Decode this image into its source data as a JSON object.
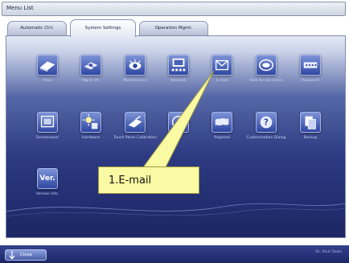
{
  "window": {
    "title": "Menu List"
  },
  "tabs": [
    {
      "label": "Automatic Ctrl."
    },
    {
      "label": "System Settings"
    },
    {
      "label": "Operation Mgmt."
    }
  ],
  "menu": {
    "row1": [
      {
        "label": "Area",
        "icon": "area-icon"
      },
      {
        "label": "Mgmt. Pt.",
        "icon": "management-point-icon"
      },
      {
        "label": "Maintenance",
        "icon": "maintenance-icon"
      },
      {
        "label": "Network",
        "icon": "network-icon"
      },
      {
        "label": "E-mail",
        "icon": "email-envelope-icon"
      },
      {
        "label": "Web Access Users",
        "icon": "web-access-users-icon"
      },
      {
        "label": "Password",
        "icon": "password-icon"
      }
    ],
    "row2": [
      {
        "label": "Screensaver",
        "icon": "screensaver-icon"
      },
      {
        "label": "Hardware",
        "icon": "hardware-icon"
      },
      {
        "label": "Touch Panel Calibration",
        "icon": "touch-panel-icon"
      },
      {
        "label": "",
        "icon": "clock-icon"
      },
      {
        "label": "Regional",
        "icon": "regional-map-icon"
      },
      {
        "label": "Customization Dialog",
        "icon": "help-question-icon"
      },
      {
        "label": "Backup",
        "icon": "backup-icon"
      }
    ],
    "row3": [
      {
        "label": "Version Info.",
        "icon": "version-info-icon",
        "icon_text": "Ver."
      }
    ]
  },
  "bottom": {
    "close_label": "Close",
    "shutdown_label": "Sh. Shut Down"
  },
  "callout": {
    "text": "1.E-mail"
  },
  "colors": {
    "accent": "#2c3a82",
    "callout_bg": "#fbfaa4"
  }
}
